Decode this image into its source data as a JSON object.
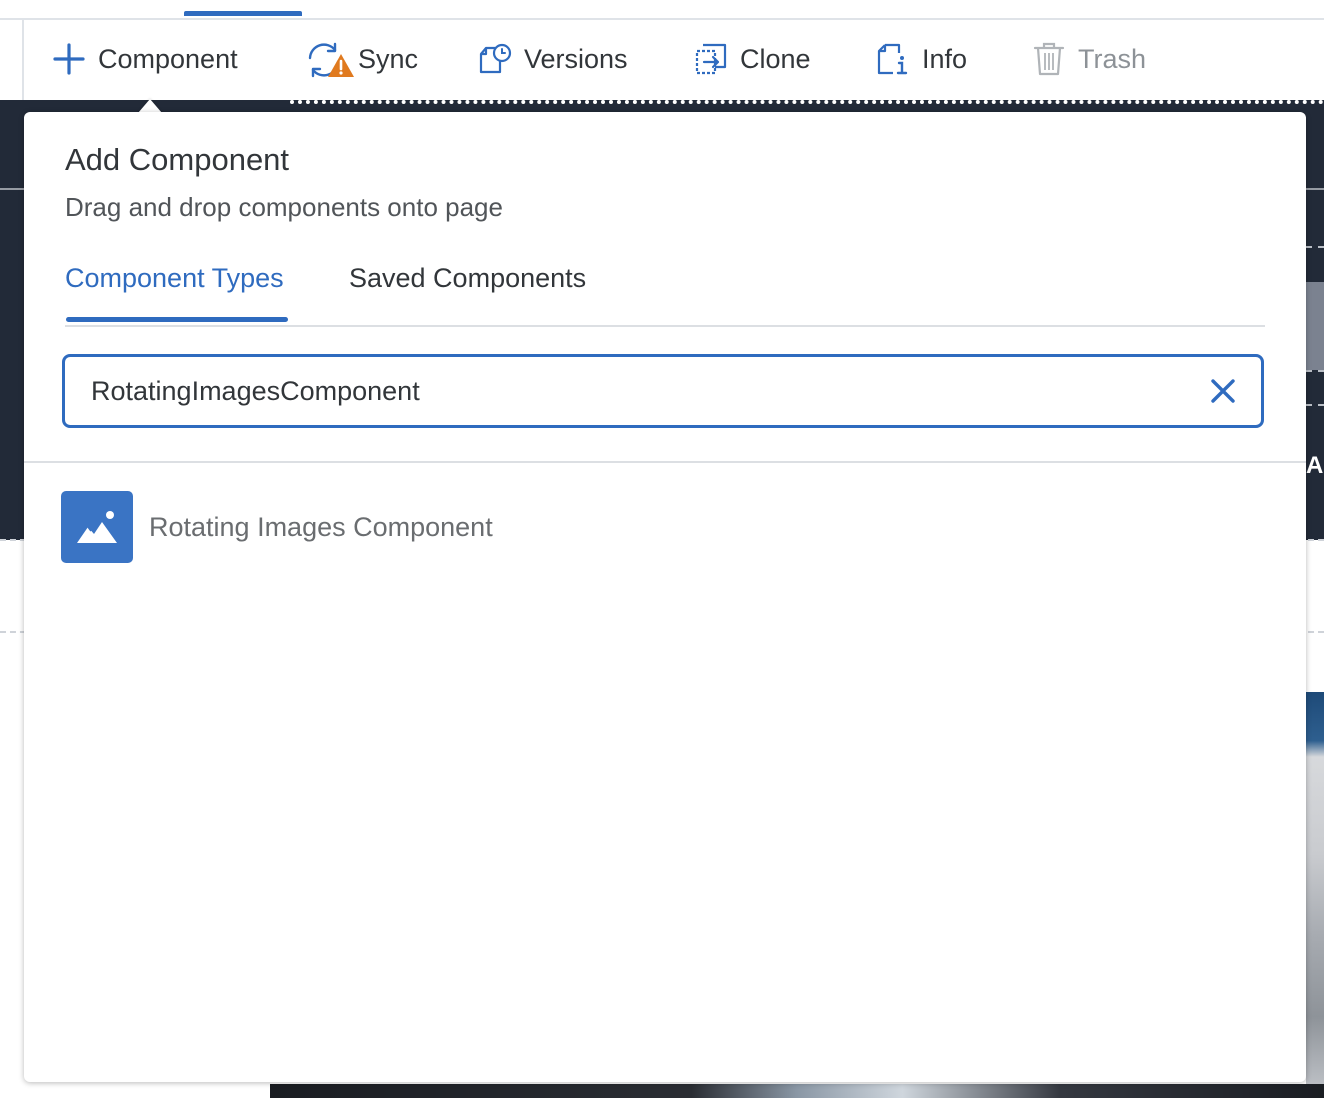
{
  "toolbar": {
    "items": [
      {
        "label": "Component",
        "icon": "plus-icon",
        "enabled": true
      },
      {
        "label": "Sync",
        "icon": "sync-warning-icon",
        "enabled": true
      },
      {
        "label": "Versions",
        "icon": "versions-icon",
        "enabled": true
      },
      {
        "label": "Clone",
        "icon": "clone-icon",
        "enabled": true
      },
      {
        "label": "Info",
        "icon": "info-icon",
        "enabled": true
      },
      {
        "label": "Trash",
        "icon": "trash-icon",
        "enabled": false
      }
    ]
  },
  "background": {
    "partial_text": "AI"
  },
  "popover": {
    "title": "Add Component",
    "subtitle": "Drag and drop components onto page",
    "tabs": [
      {
        "label": "Component Types",
        "active": true
      },
      {
        "label": "Saved Components",
        "active": false
      }
    ],
    "search": {
      "value": "RotatingImagesComponent",
      "placeholder": ""
    },
    "results": [
      {
        "label": "Rotating Images Component",
        "icon": "image-icon"
      }
    ]
  },
  "colors": {
    "accent": "#2f6bbf",
    "warning": "#e07a1f",
    "dark_background": "#222a38"
  }
}
